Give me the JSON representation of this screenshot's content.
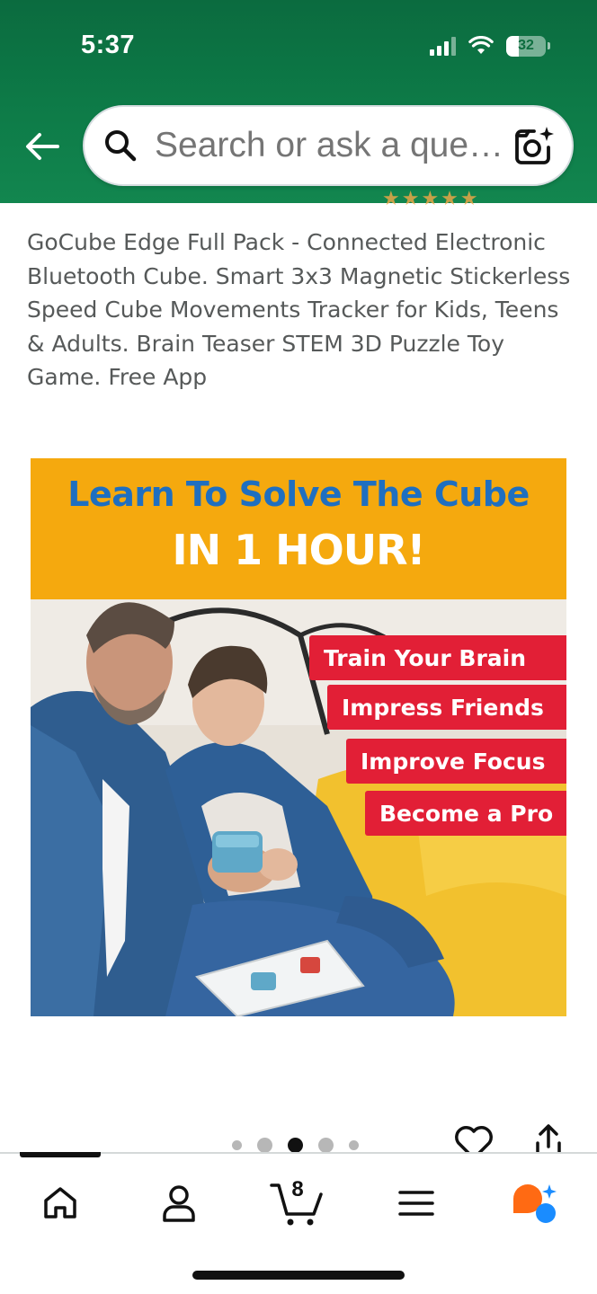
{
  "status_bar": {
    "time": "5:37",
    "battery": "32"
  },
  "search": {
    "placeholder": "Search or ask a question"
  },
  "product": {
    "title": "GoCube Edge Full Pack - Connected Electronic Bluetooth Cube. Smart 3x3 Magnetic Stickerless Speed Cube Movements Tracker for Kids, Teens & Adults. Brain Teaser STEM 3D Puzzle Toy Game. Free App"
  },
  "image": {
    "headline": "Learn To Solve The Cube",
    "subheadline": "IN 1 HOUR!",
    "tags": [
      "Train Your Brain",
      "Impress Friends",
      "Improve Focus",
      "Become a Pro"
    ]
  },
  "carousel": {
    "total": 5,
    "active_index": 2
  },
  "bottom_nav": {
    "items": [
      {
        "icon": "home-icon"
      },
      {
        "icon": "account-icon"
      },
      {
        "icon": "cart-icon",
        "count": "8"
      },
      {
        "icon": "menu-icon"
      },
      {
        "icon": "rufus-assistant-icon"
      }
    ],
    "active_index": 0
  },
  "colors": {
    "header_green": "#0d7a47",
    "banner_orange": "#f5a90e",
    "headline_blue": "#1f6fc0",
    "tag_red": "#e21f36"
  }
}
